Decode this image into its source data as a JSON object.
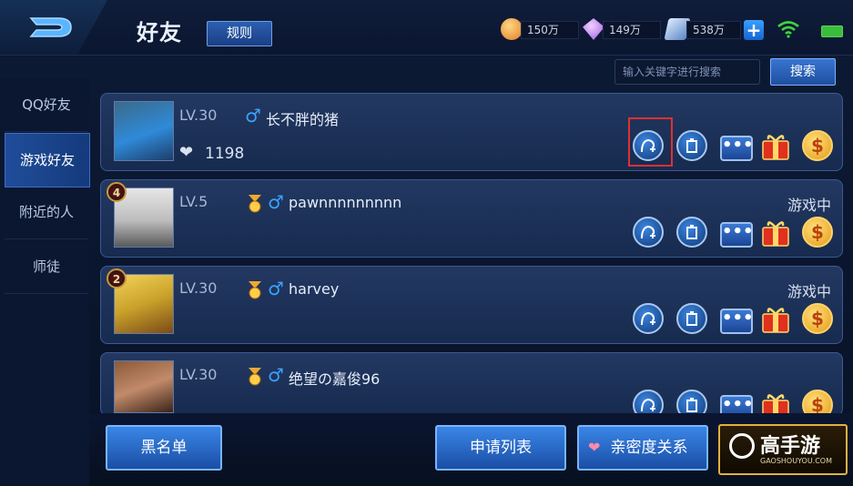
{
  "header": {
    "title": "好友",
    "rules_label": "规则",
    "currencies": [
      {
        "icon": "gold-coin-icon",
        "value": "150万",
        "color": "#f2a53a"
      },
      {
        "icon": "diamond-icon",
        "value": "149万",
        "color": "#c78cf5"
      },
      {
        "icon": "voucher-icon",
        "value": "538万",
        "color": "#8fb8e8"
      }
    ],
    "add_label": "+"
  },
  "search": {
    "placeholder": "输入关键字进行搜索",
    "button_label": "搜索"
  },
  "sidebar": {
    "items": [
      {
        "label": "QQ好友",
        "active": false
      },
      {
        "label": "游戏好友",
        "active": true
      },
      {
        "label": "附近的人",
        "active": false
      },
      {
        "label": "师徒",
        "active": false
      }
    ]
  },
  "friends": [
    {
      "level": "LV.30",
      "name": "长不胖的猪",
      "gender": "♂",
      "intimacy": "1198",
      "status": "",
      "badge": ""
    },
    {
      "level": "LV.5",
      "name": "pawnnnnnnnnn",
      "gender": "♂",
      "intimacy": "",
      "status": "游戏中",
      "badge": "4"
    },
    {
      "level": "LV.30",
      "name": "harvey",
      "gender": "♂",
      "intimacy": "",
      "status": "游戏中",
      "badge": "2"
    },
    {
      "level": "LV.30",
      "name": "绝望の嘉俊96",
      "gender": "♂",
      "intimacy": "",
      "status": "",
      "badge": ""
    }
  ],
  "bottom": {
    "blacklist_label": "黑名单",
    "requests_label": "申请列表",
    "intimacy_label": "亲密度关系",
    "logo_text": "高手游",
    "logo_sub": "GAOSHOUYOU.COM"
  },
  "colors": {
    "accent": "#2f6fd0",
    "highlight": "#e03030",
    "gender": "#3ba2ff",
    "gold": "#f0b030"
  }
}
